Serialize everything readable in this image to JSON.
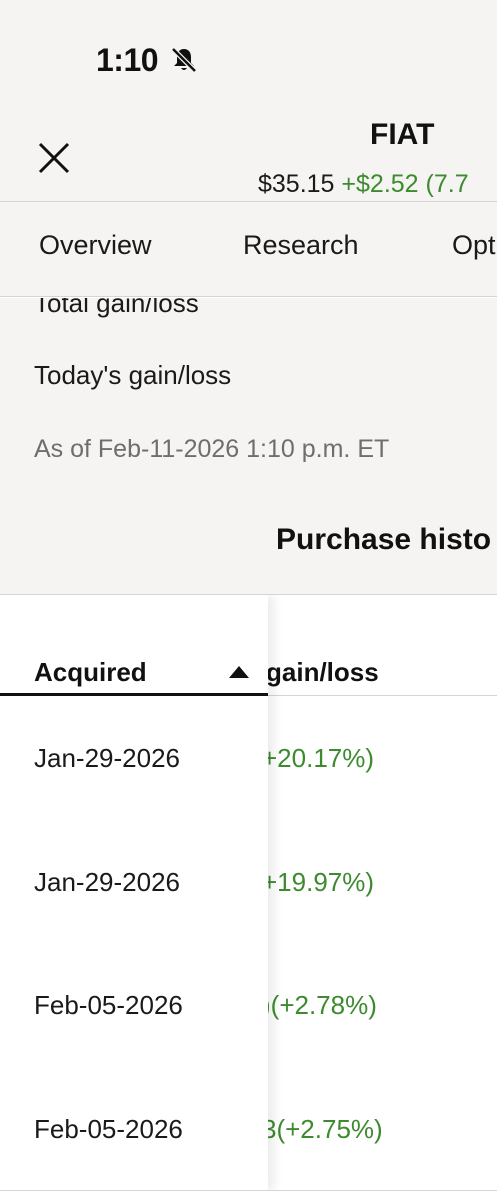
{
  "status_bar": {
    "time": "1:10",
    "icon": "bell-slash-icon"
  },
  "header": {
    "symbol": "FIAT",
    "price": "$35.15",
    "change": "+$2.52 (7.7",
    "close_icon": "close-icon"
  },
  "tabs": [
    {
      "label": "Overview"
    },
    {
      "label": "Research"
    },
    {
      "label": "Opt"
    }
  ],
  "summary": {
    "total_gain_loss_label": "Total gain/loss",
    "todays_gain_loss_label": "Today's gain/loss",
    "as_of": "As of Feb-11-2026 1:10 p.m. ET",
    "purchase_history_title": "Purchase histo"
  },
  "purchase_table": {
    "headers": {
      "acquired": "Acquired",
      "gain_loss": "gain/loss"
    },
    "sort_icon": "sort-ascending-icon",
    "rows": [
      {
        "acquired": "Jan-29-2026",
        "gain_loss": "+20.17%)"
      },
      {
        "acquired": "Jan-29-2026",
        "gain_loss": "+19.97%)"
      },
      {
        "acquired": "Feb-05-2026",
        "gain_loss": ")(+2.78%)"
      },
      {
        "acquired": "Feb-05-2026",
        "gain_loss": "3(+2.75%)"
      }
    ]
  },
  "colors": {
    "gain": "#3d8b2e",
    "background_alt": "#f5f4f2"
  }
}
